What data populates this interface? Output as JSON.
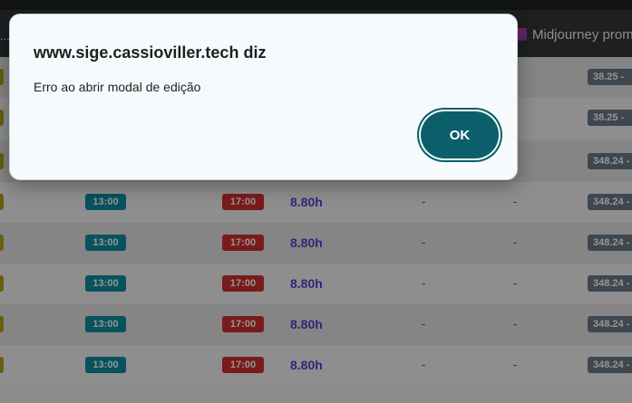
{
  "browser": {
    "overflow_marker": "...",
    "bookmark": {
      "label": "Midjourney prom",
      "icon": "midjourney-icon"
    }
  },
  "table": {
    "rows": [
      {
        "start": "",
        "end": "",
        "hours": "",
        "dash1": "",
        "dash2": "",
        "range": "38.25 -"
      },
      {
        "start": "",
        "end": "",
        "hours": "",
        "dash1": "",
        "dash2": "",
        "range": "38.25 -"
      },
      {
        "start": "",
        "end": "",
        "hours": "",
        "dash1": "",
        "dash2": "",
        "range": "348.24 -"
      },
      {
        "start": "13:00",
        "end": "17:00",
        "hours": "8.80h",
        "dash1": "-",
        "dash2": "-",
        "range": "348.24 -"
      },
      {
        "start": "13:00",
        "end": "17:00",
        "hours": "8.80h",
        "dash1": "-",
        "dash2": "-",
        "range": "348.24 -"
      },
      {
        "start": "13:00",
        "end": "17:00",
        "hours": "8.80h",
        "dash1": "-",
        "dash2": "-",
        "range": "348.24 -"
      },
      {
        "start": "13:00",
        "end": "17:00",
        "hours": "8.80h",
        "dash1": "-",
        "dash2": "-",
        "range": "348.24 -"
      },
      {
        "start": "13:00",
        "end": "17:00",
        "hours": "8.80h",
        "dash1": "-",
        "dash2": "-",
        "range": "348.24 -"
      }
    ]
  },
  "dialog": {
    "title": "www.sige.cassioviller.tech diz",
    "message": "Erro ao abrir modal de edição",
    "ok_label": "OK"
  },
  "colors": {
    "ok_button": "#0b5f6b",
    "start_chip": "#0f8ea0",
    "end_chip": "#d32f2f",
    "hours_text": "#5a3fd6"
  }
}
